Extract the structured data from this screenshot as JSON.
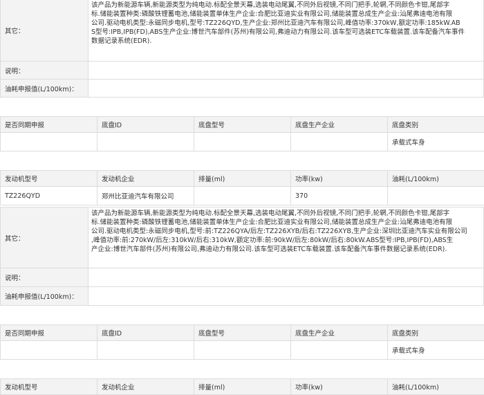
{
  "labels": {
    "other": "其它：",
    "note": "说明：",
    "fuel": "油耗申报值(L/100km)："
  },
  "chassis_headers": [
    "是否同期申报",
    "底盘ID",
    "底盘型号",
    "底盘生产企业",
    "底盘类别"
  ],
  "engine_headers": [
    "发动机型号",
    "发动机企业",
    "排量(ml)",
    "功率(kw)",
    "油耗(L/100km)"
  ],
  "sections": [
    {
      "other_lines": [
        "该产品为新能源车辆,新能源类型为纯电动.标配全景天幕,选装电动尾翼,不同外后视镜,不同门把手,轮辋,不同颜色卡钳,尾部字",
        "标.储能装置种类:磷酸铁锂蓄电池,储能装置单体生产企业:合肥比亚迪实业有限公司,储能装置总成生产企业:汕尾弗迪电池有限",
        "公司.驱动电机类型:永磁同步电机,型号:TZ226QYD,生产企业:郑州比亚迪汽车有限公司,峰值功率:370kW,额定功率:185kW.AB",
        "S型号:IPB,IPB(FD),ABS生产企业:博世汽车部件(苏州)有限公司,弗迪动力有限公司.该车型可选装ETC车载装置.该车配备汽车事件",
        "数据记录系统(EDR)."
      ],
      "note": "",
      "fuel": "",
      "chassis_row": [
        "",
        "",
        "",
        "",
        "承载式车身"
      ],
      "engine_row": [
        "TZ226QYD",
        "郑州比亚迪汽车有限公司",
        "",
        "370",
        ""
      ]
    },
    {
      "other_lines": [
        "该产品为新能源车辆,新能源类型为纯电动.标配全景天幕,选装电动尾翼,不同外后视镜,不同门把手,轮辋,不同颜色卡钳,尾部字",
        "标.储能装置种类:磷酸铁锂蓄电池,储能装置单体生产企业:合肥比亚迪实业有限公司,储能装置总成生产企业:汕尾弗迪电池有限",
        "公司.驱动电机类型:永磁同步电机,型号:前:TZ226QYA/后左:TZ226XYB/后右:TZ226XYB,生产企业:深圳比亚迪汽车实业有限公司",
        ",峰值功率:前:270kW/后左:310kW/后右:310kW,额定功率:前:90kW/后左:80kW/后右:80kW.ABS型号:IPB,IPB(FD),ABS生",
        "产企业:博世汽车部件(苏州)有限公司,弗迪动力有限公司.该车型可选装ETC车载装置.该车配备汽车事件数据记录系统(EDR)."
      ],
      "note": "",
      "fuel": "",
      "chassis_row": [
        "",
        "",
        "",
        "",
        "承载式车身"
      ]
    }
  ]
}
